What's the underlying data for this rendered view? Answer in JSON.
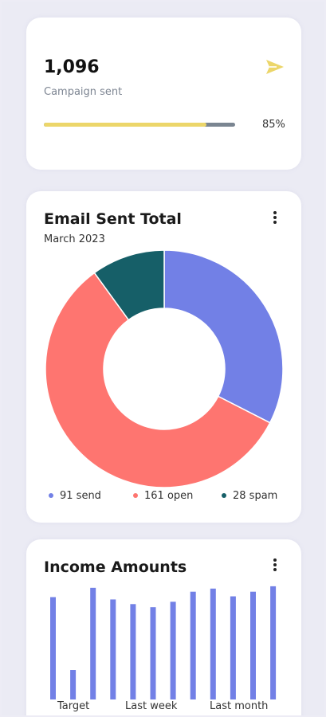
{
  "campaign": {
    "value": "1,096",
    "label": "Campaign sent",
    "progress_percent": 85,
    "progress_label": "85%",
    "icon": "send-icon",
    "accent_color": "#ecd66a"
  },
  "email_total": {
    "title": "Email Sent Total",
    "subtitle": "March 2023",
    "menu_icon": "more-vertical-icon",
    "chart_data": {
      "type": "pie",
      "donut": true,
      "slices": [
        {
          "label": "send",
          "value": 91,
          "color": "#7280e6"
        },
        {
          "label": "open",
          "value": 161,
          "color": "#fe7570"
        },
        {
          "label": "spam",
          "value": 28,
          "color": "#165f68"
        }
      ]
    },
    "legend": [
      {
        "text": "91 send"
      },
      {
        "text": "161 open"
      },
      {
        "text": "28 spam"
      }
    ]
  },
  "income": {
    "title": "Income Amounts",
    "menu_icon": "more-vertical-icon",
    "x_labels": [
      "Target",
      "Last week",
      "Last month"
    ],
    "chart_data": {
      "type": "bar",
      "color": "#7280e6",
      "values": [
        132,
        38,
        144,
        129,
        123,
        119,
        126,
        139,
        143,
        133,
        139,
        146
      ],
      "ylim": [
        0,
        150
      ]
    }
  }
}
